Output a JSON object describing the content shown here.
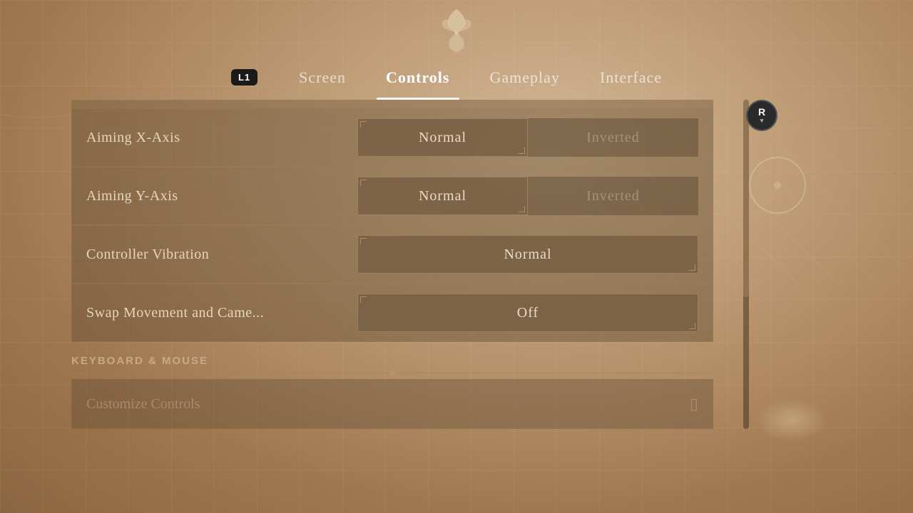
{
  "nav": {
    "l1_label": "L1",
    "tabs": [
      {
        "id": "screen",
        "label": "Screen",
        "active": false
      },
      {
        "id": "controls",
        "label": "Controls",
        "active": true
      },
      {
        "id": "gameplay",
        "label": "Gameplay",
        "active": false
      },
      {
        "id": "interface",
        "label": "Interface",
        "active": false
      }
    ]
  },
  "settings": {
    "rows": [
      {
        "id": "aiming-x",
        "label": "Aiming X-Axis",
        "options": [
          {
            "label": "Normal",
            "selected": true
          },
          {
            "label": "Inverted",
            "selected": false
          }
        ]
      },
      {
        "id": "aiming-y",
        "label": "Aiming Y-Axis",
        "options": [
          {
            "label": "Normal",
            "selected": true
          },
          {
            "label": "Inverted",
            "selected": false
          }
        ]
      },
      {
        "id": "controller-vibration",
        "label": "Controller Vibration",
        "options": [
          {
            "label": "Normal",
            "selected": true,
            "full": true
          }
        ]
      },
      {
        "id": "swap-movement",
        "label": "Swap Movement and Came...",
        "options": [
          {
            "label": "Off",
            "selected": true,
            "full": true
          }
        ]
      }
    ],
    "section_keyboard": "KEYBOARD & MOUSE",
    "customize_label": "Customize Controls",
    "r_button_label": "R",
    "r_button_sub": "▾"
  }
}
